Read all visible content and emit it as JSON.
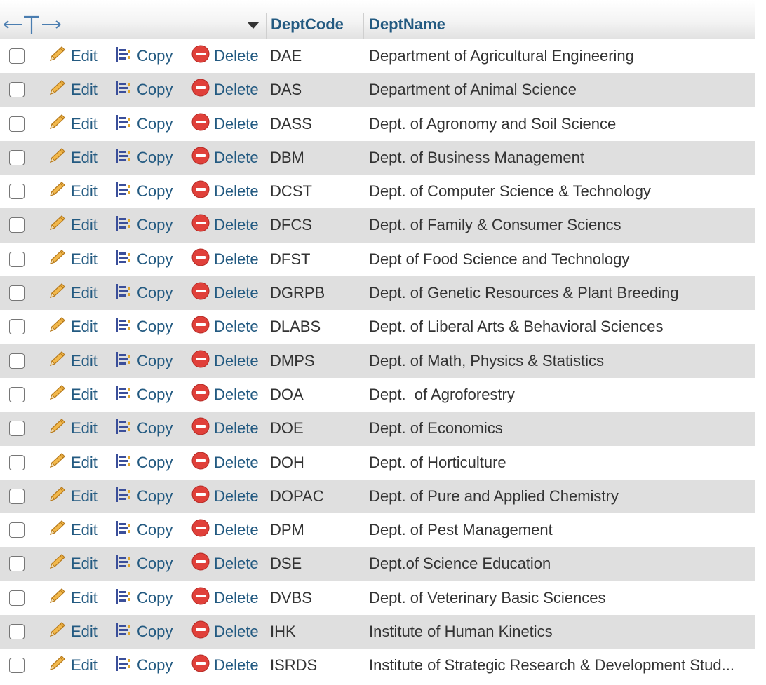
{
  "table": {
    "columns": [
      {
        "label": "DeptCode"
      },
      {
        "label": "DeptName"
      }
    ],
    "actions": {
      "edit": "Edit",
      "copy": "Copy",
      "delete": "Delete"
    },
    "rows": [
      {
        "code": "DAE",
        "name": "Department of Agricultural Engineering"
      },
      {
        "code": "DAS",
        "name": "Department of Animal Science"
      },
      {
        "code": "DASS",
        "name": "Dept. of Agronomy and Soil Science"
      },
      {
        "code": "DBM",
        "name": "Dept. of Business Management"
      },
      {
        "code": "DCST",
        "name": "Dept. of Computer Science & Technology"
      },
      {
        "code": "DFCS",
        "name": "Dept. of Family & Consumer Sciencs"
      },
      {
        "code": "DFST",
        "name": "Dept of Food Science and Technology"
      },
      {
        "code": "DGRPB",
        "name": "Dept. of Genetic Resources & Plant Breeding"
      },
      {
        "code": "DLABS",
        "name": "Dept. of Liberal Arts & Behavioral Sciences"
      },
      {
        "code": "DMPS",
        "name": "Dept. of Math, Physics & Statistics"
      },
      {
        "code": "DOA",
        "name": "Dept.  of Agroforestry"
      },
      {
        "code": "DOE",
        "name": "Dept. of Economics"
      },
      {
        "code": "DOH",
        "name": "Dept. of Horticulture"
      },
      {
        "code": "DOPAC",
        "name": "Dept. of Pure and Applied Chemistry"
      },
      {
        "code": "DPM",
        "name": "Dept. of Pest Management"
      },
      {
        "code": "DSE",
        "name": "Dept.of Science Education"
      },
      {
        "code": "DVBS",
        "name": "Dept. of Veterinary Basic Sciences"
      },
      {
        "code": "IHK",
        "name": "Institute of Human Kinetics"
      },
      {
        "code": "ISRDS",
        "name": "Institute of Strategic Research & Development Stud..."
      }
    ]
  },
  "icons": {
    "nav": "left-right-arrows-icon",
    "sort": "triangle-down-icon",
    "edit": "pencil-icon",
    "copy": "copy-icon",
    "delete": "delete-icon"
  },
  "colors": {
    "link": "#235a81",
    "row_alt": "#dfdfdf",
    "delete_red": "#e0403a",
    "pencil": "#e8a33d"
  }
}
